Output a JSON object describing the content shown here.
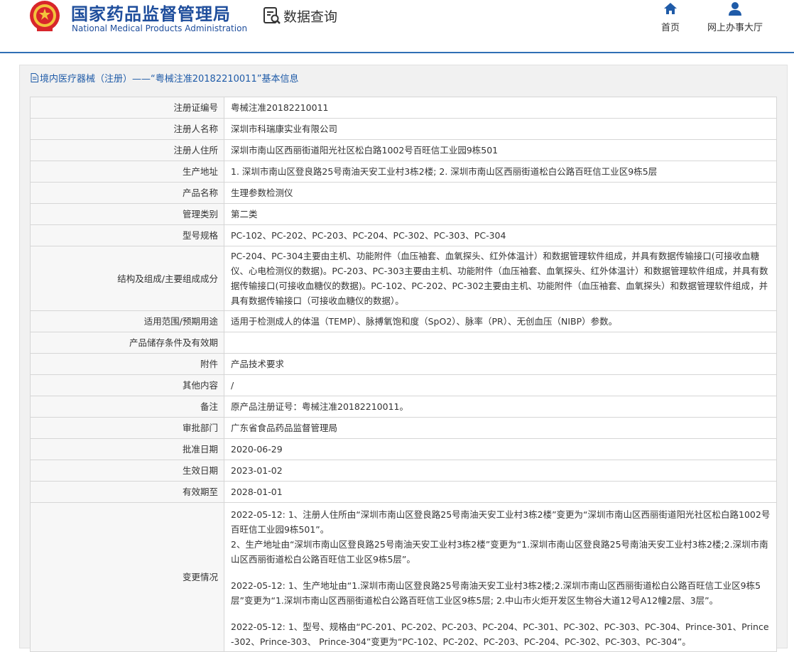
{
  "header": {
    "agency_cn": "国家药品监督管理局",
    "agency_en": "National Medical Products Administration",
    "query_label": "数据查询",
    "nav": [
      {
        "label": "首页",
        "icon": "home-icon"
      },
      {
        "label": "网上办事大厅",
        "icon": "user-icon"
      }
    ],
    "accent_color": "#1f4e9c"
  },
  "panel": {
    "title": "境内医疗器械（注册）——“粤械注准20182210011”基本信息"
  },
  "rows": [
    {
      "label": "注册证编号",
      "value": "粤械注准20182210011"
    },
    {
      "label": "注册人名称",
      "value": "深圳市科瑞康实业有限公司"
    },
    {
      "label": "注册人住所",
      "value": "深圳市南山区西丽街道阳光社区松白路1002号百旺信工业园9栋501"
    },
    {
      "label": "生产地址",
      "value": "1. 深圳市南山区登良路25号南油天安工业村3栋2楼; 2. 深圳市南山区西丽街道松白公路百旺信工业区9栋5层"
    },
    {
      "label": "产品名称",
      "value": "生理参数检测仪"
    },
    {
      "label": "管理类别",
      "value": "第二类"
    },
    {
      "label": "型号规格",
      "value": "PC-102、PC-202、PC-203、PC-204、PC-302、PC-303、PC-304"
    },
    {
      "label": "结构及组成/主要组成成分",
      "value": "PC-204、PC-304主要由主机、功能附件（血压袖套、血氧探头、红外体温计）和数据管理软件组成，并具有数据传输接口(可接收血糖仪、心电检测仪的数据)。PC-203、PC-303主要由主机、功能附件（血压袖套、血氧探头、红外体温计）和数据管理软件组成，并具有数据传输接口(可接收血糖仪的数据)。PC-102、PC-202、PC-302主要由主机、功能附件（血压袖套、血氧探头）和数据管理软件组成，并具有数据传输接口（可接收血糖仪的数据）。"
    },
    {
      "label": "适用范围/预期用途",
      "value": "适用于检测成人的体温（TEMP）、脉搏氧饱和度（SpO2）、脉率（PR）、无创血压（NIBP）参数。"
    },
    {
      "label": "产品储存条件及有效期",
      "value": ""
    },
    {
      "label": "附件",
      "value": "产品技术要求"
    },
    {
      "label": "其他内容",
      "value": "/"
    },
    {
      "label": "备注",
      "value": "原产品注册证号：粤械注准20182210011。"
    },
    {
      "label": "审批部门",
      "value": "广东省食品药品监督管理局"
    },
    {
      "label": "批准日期",
      "value": "2020-06-29"
    },
    {
      "label": "生效日期",
      "value": "2023-01-02"
    },
    {
      "label": "有效期至",
      "value": "2028-01-01"
    }
  ],
  "changes": {
    "label": "变更情况",
    "entries": [
      "2022-05-12: 1、注册人住所由“深圳市南山区登良路25号南油天安工业村3栋2楼”变更为“深圳市南山区西丽街道阳光社区松白路1002号百旺信工业园9栋501”。\n2、生产地址由“深圳市南山区登良路25号南油天安工业村3栋2楼”变更为“1.深圳市南山区登良路25号南油天安工业村3栋2楼;2.深圳市南山区西丽街道松白公路百旺信工业区9栋5层”。",
      "2022-05-12: 1、生产地址由“1.深圳市南山区登良路25号南油天安工业村3栋2楼;2.深圳市南山区西丽街道松白公路百旺信工业区9栋5层”变更为“1.深圳市南山区西丽街道松白公路百旺信工业区9栋5层; 2.中山市火炬开发区生物谷大道12号A12幢2层、3层”。",
      "2022-05-12: 1、型号、规格由“PC-201、PC-202、PC-203、PC-204、PC-301、PC-302、PC-303、PC-304、Prince-301、Prince-302、Prince-303、 Prince-304”变更为“PC-102、PC-202、PC-203、PC-204、PC-302、PC-303、PC-304”。"
    ]
  }
}
